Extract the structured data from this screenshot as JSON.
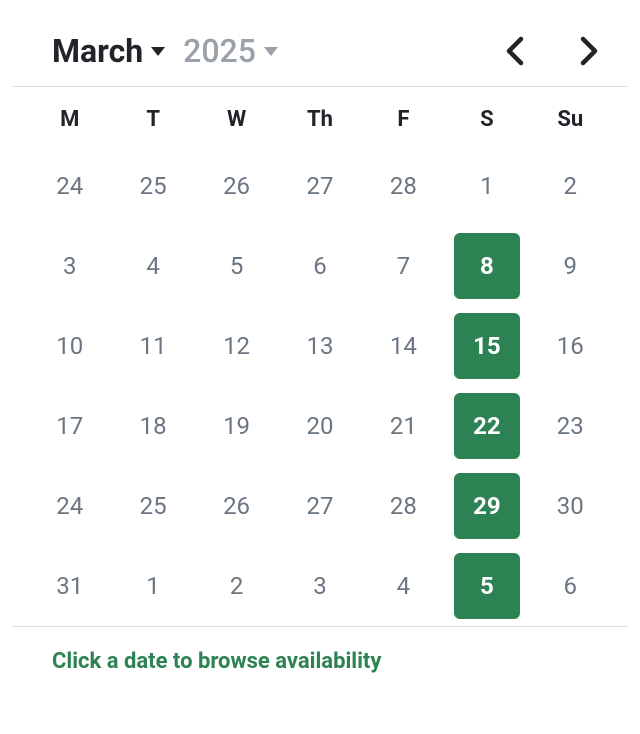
{
  "header": {
    "month": "March",
    "year": "2025"
  },
  "dayHeaders": [
    "M",
    "T",
    "W",
    "Th",
    "F",
    "S",
    "Su"
  ],
  "weeks": [
    [
      {
        "n": "24",
        "available": false
      },
      {
        "n": "25",
        "available": false
      },
      {
        "n": "26",
        "available": false
      },
      {
        "n": "27",
        "available": false
      },
      {
        "n": "28",
        "available": false
      },
      {
        "n": "1",
        "available": false
      },
      {
        "n": "2",
        "available": false
      }
    ],
    [
      {
        "n": "3",
        "available": false
      },
      {
        "n": "4",
        "available": false
      },
      {
        "n": "5",
        "available": false
      },
      {
        "n": "6",
        "available": false
      },
      {
        "n": "7",
        "available": false
      },
      {
        "n": "8",
        "available": true
      },
      {
        "n": "9",
        "available": false
      }
    ],
    [
      {
        "n": "10",
        "available": false
      },
      {
        "n": "11",
        "available": false
      },
      {
        "n": "12",
        "available": false
      },
      {
        "n": "13",
        "available": false
      },
      {
        "n": "14",
        "available": false
      },
      {
        "n": "15",
        "available": true
      },
      {
        "n": "16",
        "available": false
      }
    ],
    [
      {
        "n": "17",
        "available": false
      },
      {
        "n": "18",
        "available": false
      },
      {
        "n": "19",
        "available": false
      },
      {
        "n": "20",
        "available": false
      },
      {
        "n": "21",
        "available": false
      },
      {
        "n": "22",
        "available": true
      },
      {
        "n": "23",
        "available": false
      }
    ],
    [
      {
        "n": "24",
        "available": false
      },
      {
        "n": "25",
        "available": false
      },
      {
        "n": "26",
        "available": false
      },
      {
        "n": "27",
        "available": false
      },
      {
        "n": "28",
        "available": false
      },
      {
        "n": "29",
        "available": true
      },
      {
        "n": "30",
        "available": false
      }
    ],
    [
      {
        "n": "31",
        "available": false
      },
      {
        "n": "1",
        "available": false
      },
      {
        "n": "2",
        "available": false
      },
      {
        "n": "3",
        "available": false
      },
      {
        "n": "4",
        "available": false
      },
      {
        "n": "5",
        "available": true
      },
      {
        "n": "6",
        "available": false
      }
    ]
  ],
  "footerHint": "Click a date to browse availability",
  "colors": {
    "accent": "#2d8253"
  }
}
